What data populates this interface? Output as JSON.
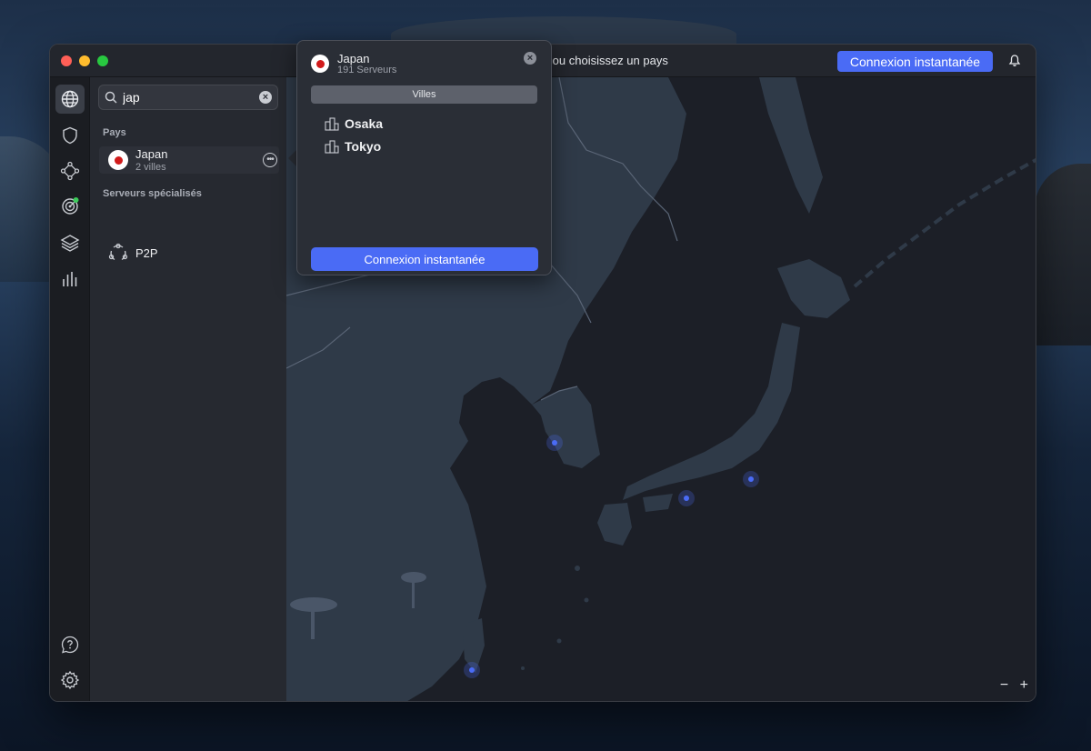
{
  "window": {
    "status_text": "ous maintenant ou choisissez un pays",
    "connect_label": "Connexion instantanée"
  },
  "iconbar": {
    "top_icons": [
      "globe-icon",
      "shield-icon",
      "meshnet-icon",
      "radar-icon",
      "layers-icon",
      "stats-icon"
    ],
    "bottom_icons": [
      "help-icon",
      "gear-icon"
    ]
  },
  "sidebar": {
    "search": {
      "value": "jap",
      "placeholder": ""
    },
    "countries_label": "Pays",
    "countries": [
      {
        "name": "Japan",
        "sub": "2 villes"
      }
    ],
    "specialty_label": "Serveurs spécialisés",
    "specialty": [
      {
        "name": "P2P"
      }
    ]
  },
  "popover": {
    "country": "Japan",
    "servers": "191 Serveurs",
    "tab_label": "Villes",
    "cities": [
      "Osaka",
      "Tokyo"
    ],
    "connect_label": "Connexion instantanée"
  },
  "map": {
    "zoom_out": "−",
    "zoom_in": "+"
  },
  "colors": {
    "accent": "#4a6bf5",
    "land": "#2f3a48",
    "sea": "#1c1f27",
    "server_dot": "#4a6bf5",
    "status_dot": "#3ccb5a"
  }
}
